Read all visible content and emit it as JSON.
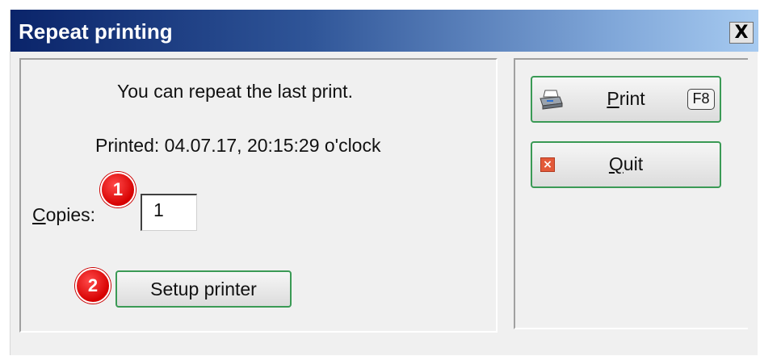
{
  "window": {
    "title": "Repeat printing",
    "close_label": "X"
  },
  "main": {
    "message": "You can repeat the last print.",
    "printed": "Printed: 04.07.17, 20:15:29 o'clock",
    "copies": {
      "label_first": "C",
      "label_rest": "opies:",
      "value": "1"
    },
    "setup_button": "Setup printer"
  },
  "buttons": {
    "print": {
      "underlined": "P",
      "rest": "rint",
      "shortcut": "F8",
      "icon": "printer-icon"
    },
    "quit": {
      "underlined": "Q",
      "rest": "uit",
      "icon": "close-icon"
    }
  },
  "markers": [
    "1",
    "2"
  ],
  "colors": {
    "title_start": "#0a246a",
    "title_end": "#a6caf0",
    "button_border": "#3a9a55",
    "marker": "#d60000"
  }
}
